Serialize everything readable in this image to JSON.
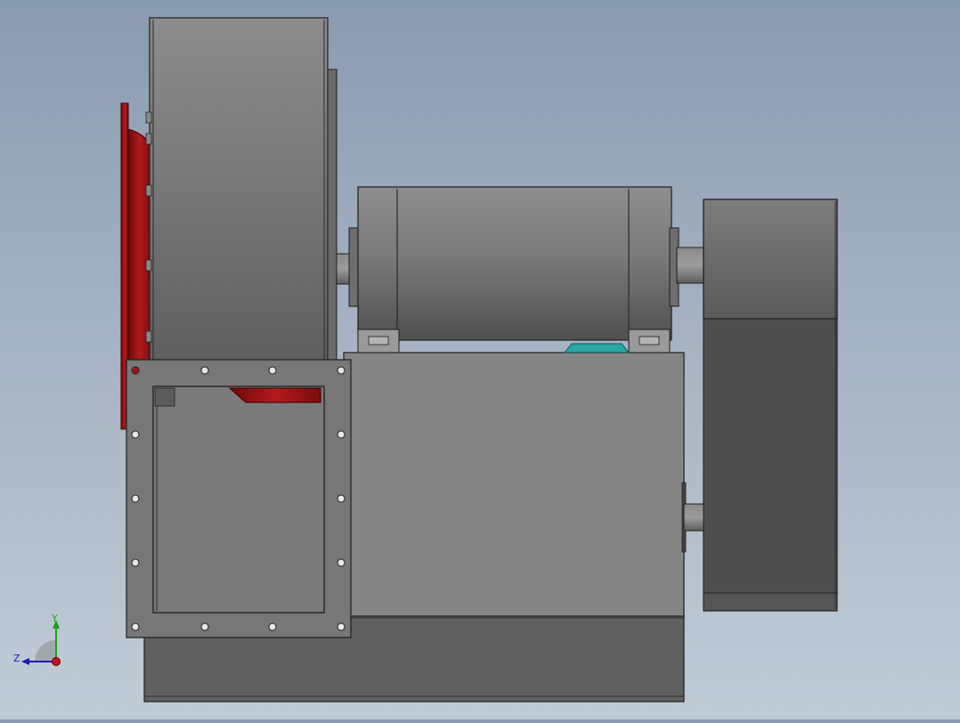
{
  "viewport": {
    "background_top": "#8a9bb0",
    "background_bottom": "#c2ccd7",
    "model": {
      "part_colors": {
        "housing": "#7a7a7a",
        "housing_dark": "#555555",
        "impeller_red": "#a31616",
        "accent_teal": "#2aa6a6",
        "edge_line": "#1e1e1e"
      }
    }
  },
  "triad": {
    "x_label": "",
    "y_label": "Y",
    "z_label": "Z",
    "y_color": "#1aa01a",
    "z_color": "#1a1ab4",
    "origin_color": "#c81414"
  }
}
